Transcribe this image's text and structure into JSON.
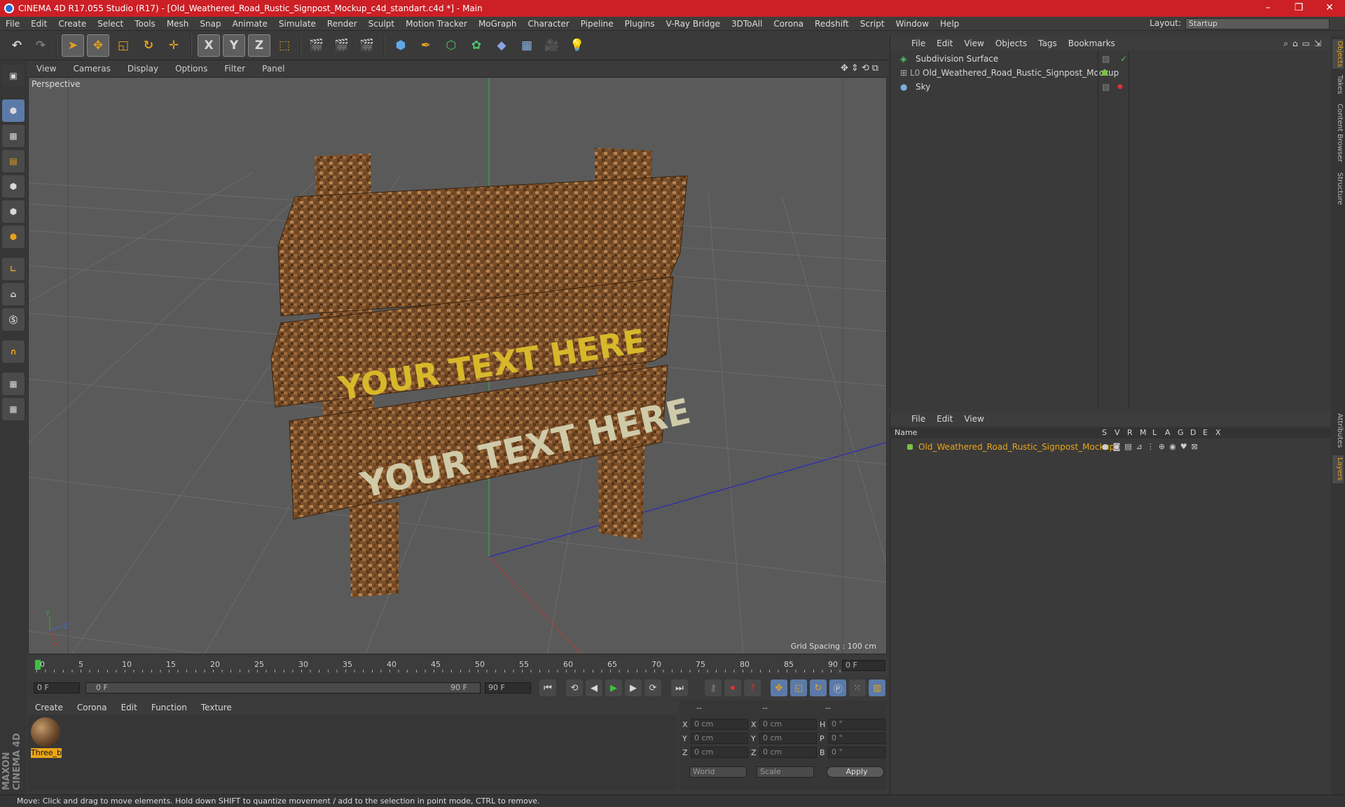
{
  "window": {
    "title": "CINEMA 4D R17.055 Studio (R17) - [Old_Weathered_Road_Rustic_Signpost_Mockup_c4d_standart.c4d *] - Main",
    "minimize": "–",
    "maximize": "❐",
    "close": "✕"
  },
  "menubar": {
    "items": [
      "File",
      "Edit",
      "Create",
      "Select",
      "Tools",
      "Mesh",
      "Snap",
      "Animate",
      "Simulate",
      "Render",
      "Sculpt",
      "Motion Tracker",
      "MoGraph",
      "Character",
      "Pipeline",
      "Plugins",
      "V-Ray Bridge",
      "3DToAll",
      "Corona",
      "Redshift",
      "Script",
      "Window",
      "Help"
    ],
    "layout_label": "Layout:",
    "layout_value": "Startup"
  },
  "toolbar": {
    "x_axis": "X",
    "y_axis": "Y",
    "z_axis": "Z"
  },
  "viewport": {
    "menu": [
      "View",
      "Cameras",
      "Display",
      "Options",
      "Filter",
      "Panel"
    ],
    "label": "Perspective",
    "grid_spacing": "Grid Spacing : 100 cm",
    "sign_text_middle": "YOUR TEXT HERE",
    "sign_text_bottom": "YOUR TEXT HERE",
    "axis_y": "Y",
    "axis_z": "Z",
    "axis_x": "X"
  },
  "timeline": {
    "ticks": [
      "0",
      "5",
      "10",
      "15",
      "20",
      "25",
      "30",
      "35",
      "40",
      "45",
      "50",
      "55",
      "60",
      "65",
      "70",
      "75",
      "80",
      "85",
      "90"
    ],
    "current_frame": "0 F"
  },
  "transport": {
    "start_field": "0 F",
    "range_start": "0 F",
    "range_end": "90 F",
    "end_field": "90 F"
  },
  "material_manager": {
    "menu": [
      "Create",
      "Corona",
      "Edit",
      "Function",
      "Texture"
    ],
    "material_name": "Three_b"
  },
  "coordinates": {
    "header": [
      "--",
      "--",
      "--"
    ],
    "rows": [
      {
        "l1": "X",
        "v1": "0 cm",
        "l2": "X",
        "v2": "0 cm",
        "l3": "H",
        "v3": "0 °"
      },
      {
        "l1": "Y",
        "v1": "0 cm",
        "l2": "Y",
        "v2": "0 cm",
        "l3": "P",
        "v3": "0 °"
      },
      {
        "l1": "Z",
        "v1": "0 cm",
        "l2": "Z",
        "v2": "0 cm",
        "l3": "B",
        "v3": "0 °"
      }
    ],
    "mode": "World",
    "scale": "Scale",
    "apply": "Apply"
  },
  "object_manager": {
    "menu": [
      "File",
      "Edit",
      "View",
      "Objects",
      "Tags",
      "Bookmarks"
    ],
    "objects": [
      {
        "name": "Subdivision Surface"
      },
      {
        "name": "Old_Weathered_Road_Rustic_Signpost_Mockup"
      },
      {
        "name": "Sky"
      }
    ]
  },
  "layer_manager": {
    "menu": [
      "File",
      "Edit",
      "View"
    ],
    "name_header": "Name",
    "col_headers": [
      "S",
      "V",
      "R",
      "M",
      "L",
      "A",
      "G",
      "D",
      "E",
      "X"
    ],
    "layer_name": "Old_Weathered_Road_Rustic_Signpost_Mockup"
  },
  "right_tabs": [
    "Objects",
    "Takes",
    "Content Browser",
    "Structure",
    "Attributes",
    "Layers"
  ],
  "status": "Move: Click and drag to move elements. Hold down SHIFT to quantize movement / add to the selection in point mode, CTRL to remove.",
  "branding": "MAXON CINEMA 4D",
  "colors": {
    "title_bar": "#cc1f26",
    "accent": "#e9a51a",
    "layer_green": "#7ac143"
  }
}
